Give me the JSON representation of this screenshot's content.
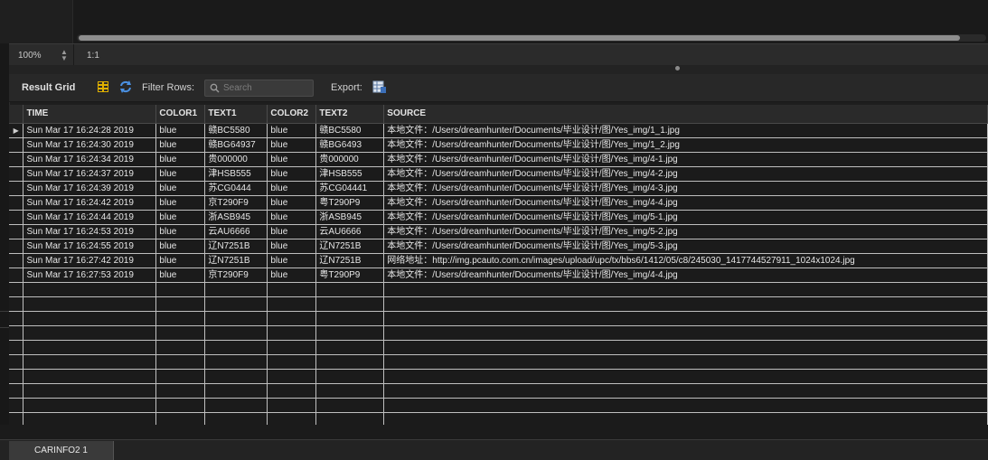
{
  "zoom": {
    "value": "100%",
    "actual_size": "1:1"
  },
  "toolbar": {
    "result_grid_label": "Result Grid",
    "filter_rows_label": "Filter Rows:",
    "search_placeholder": "Search",
    "export_label": "Export:"
  },
  "grid": {
    "columns": [
      "TIME",
      "COLOR1",
      "TEXT1",
      "COLOR2",
      "TEXT2",
      "SOURCE"
    ],
    "rows": [
      [
        "Sun Mar 17 16:24:28 2019",
        "blue",
        "赣BC5580",
        "blue",
        "赣BC5580",
        "本地文件：/Users/dreamhunter/Documents/毕业设计/图/Yes_img/1_1.jpg"
      ],
      [
        "Sun Mar 17 16:24:30 2019",
        "blue",
        "赣BG64937",
        "blue",
        "赣BG6493",
        "本地文件：/Users/dreamhunter/Documents/毕业设计/图/Yes_img/1_2.jpg"
      ],
      [
        "Sun Mar 17 16:24:34 2019",
        "blue",
        "贵000000",
        "blue",
        "贵000000",
        "本地文件：/Users/dreamhunter/Documents/毕业设计/图/Yes_img/4-1.jpg"
      ],
      [
        "Sun Mar 17 16:24:37 2019",
        "blue",
        "津HSB555",
        "blue",
        "津HSB555",
        "本地文件：/Users/dreamhunter/Documents/毕业设计/图/Yes_img/4-2.jpg"
      ],
      [
        "Sun Mar 17 16:24:39 2019",
        "blue",
        "苏CG0444",
        "blue",
        "苏CG04441",
        "本地文件：/Users/dreamhunter/Documents/毕业设计/图/Yes_img/4-3.jpg"
      ],
      [
        "Sun Mar 17 16:24:42 2019",
        "blue",
        "京T290F9",
        "blue",
        "粤T290P9",
        "本地文件：/Users/dreamhunter/Documents/毕业设计/图/Yes_img/4-4.jpg"
      ],
      [
        "Sun Mar 17 16:24:44 2019",
        "blue",
        "浙ASB945",
        "blue",
        "浙ASB945",
        "本地文件：/Users/dreamhunter/Documents/毕业设计/图/Yes_img/5-1.jpg"
      ],
      [
        "Sun Mar 17 16:24:53 2019",
        "blue",
        "云AU6666",
        "blue",
        "云AU6666",
        "本地文件：/Users/dreamhunter/Documents/毕业设计/图/Yes_img/5-2.jpg"
      ],
      [
        "Sun Mar 17 16:24:55 2019",
        "blue",
        "辽N7251B",
        "blue",
        "辽N7251B",
        "本地文件：/Users/dreamhunter/Documents/毕业设计/图/Yes_img/5-3.jpg"
      ],
      [
        "Sun Mar 17 16:27:42 2019",
        "blue",
        "辽N7251B",
        "blue",
        "辽N7251B",
        "网络地址：http://img.pcauto.com.cn/images/upload/upc/tx/bbs6/1412/05/c8/245030_1417744527911_1024x1024.jpg"
      ],
      [
        "Sun Mar 17 16:27:53 2019",
        "blue",
        "京T290F9",
        "blue",
        "粤T290P9",
        "本地文件：/Users/dreamhunter/Documents/毕业设计/图/Yes_img/4-4.jpg"
      ]
    ],
    "selected_row": 0
  },
  "tabs": [
    {
      "label": "CARINFO2 1"
    }
  ],
  "icons": {
    "form_editor": "form-editor-icon",
    "refresh": "refresh-icon",
    "search": "search-icon",
    "export": "export-icon",
    "row_marker": "row-pointer-icon"
  },
  "colors": {
    "background": "#1e1e1e",
    "grid_lines": "#bfbfbf",
    "scroll_thumb": "#8e8e8e",
    "refresh_icon": "#4a90e2",
    "form_icon": "#e0b000"
  }
}
